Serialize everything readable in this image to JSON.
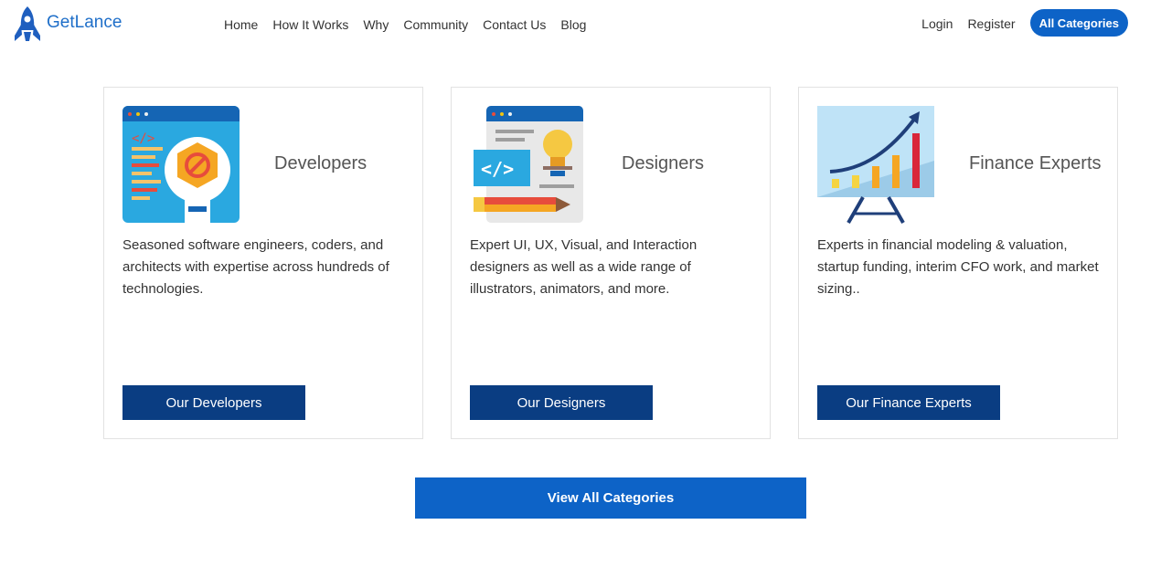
{
  "brand": {
    "name": "GetLance",
    "logo_icon": "rocket-icon"
  },
  "nav": {
    "items": [
      "Home",
      "How It Works",
      "Why",
      "Community",
      "Contact Us",
      "Blog"
    ]
  },
  "auth": {
    "login": "Login",
    "register": "Register",
    "all_categories": "All Categories"
  },
  "colors": {
    "accent": "#0d63c7",
    "button_dark": "#0a3d82",
    "brand": "#1f6fc9"
  },
  "cards": [
    {
      "title": "Developers",
      "description": "Seasoned software engineers, coders, and architects with expertise across hundreds of technologies.",
      "button": "Our Developers",
      "icon": "developer-wrench-icon"
    },
    {
      "title": "Designers",
      "description": "Expert UI, UX, Visual, and Interaction designers as well as a wide range of illustrators, animators, and more.",
      "button": "Our Designers",
      "icon": "designer-bulb-icon"
    },
    {
      "title": "Finance Experts",
      "description": "Experts in financial modeling & valuation, startup funding, interim CFO work, and market sizing..",
      "button": "Our Finance Experts",
      "icon": "finance-chart-icon"
    }
  ],
  "cta": {
    "label": "View All Categories"
  }
}
